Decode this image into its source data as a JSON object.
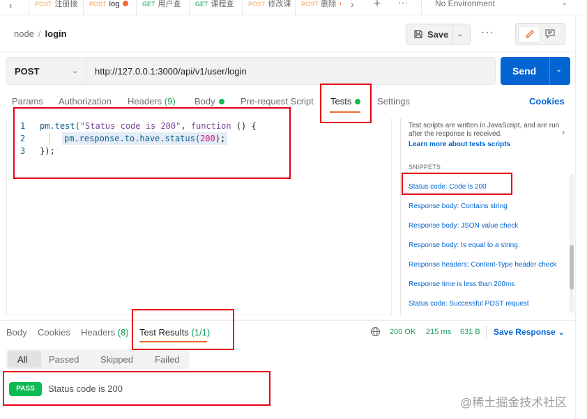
{
  "tabs": [
    {
      "method": "POST",
      "name": "注册接"
    },
    {
      "method": "POST",
      "name": "log"
    },
    {
      "method": "GET",
      "name": "用户查"
    },
    {
      "method": "GET",
      "name": "课程查"
    },
    {
      "method": "POST",
      "name": "修改课"
    },
    {
      "method": "POST",
      "name": "删除"
    }
  ],
  "environment": "No Environment",
  "breadcrumb": {
    "collection": "node",
    "separator": "/",
    "request": "login"
  },
  "toolbar": {
    "save_label": "Save"
  },
  "request": {
    "method": "POST",
    "url": "http://127.0.0.1:3000/api/v1/user/login",
    "send_label": "Send"
  },
  "request_tabs": {
    "params": "Params",
    "authorization": "Authorization",
    "headers": "Headers",
    "headers_count": "(9)",
    "body": "Body",
    "prerequest": "Pre-request Script",
    "tests": "Tests",
    "settings": "Settings",
    "cookies": "Cookies"
  },
  "editor": {
    "lines": [
      "1",
      "2",
      "3"
    ],
    "l1_a": "pm.test(",
    "l1_b": "\"Status code is 200\"",
    "l1_c": ", ",
    "l1_d": "function",
    "l1_e": " () {",
    "l2_a": "pm.response.to.have.status(",
    "l2_b": "200",
    "l2_c": ");",
    "l3": "});"
  },
  "snippets": {
    "help_text": "Test scripts are written in JavaScript, and are run after the response is received.",
    "help_link": "Learn more about tests scripts",
    "heading": "SNIPPETS",
    "items": [
      "Status code: Code is 200",
      "Response body: Contains string",
      "Response body: JSON value check",
      "Response body: Is equal to a string",
      "Response headers: Content-Type header check",
      "Response time is less than 200ms",
      "Status code: Successful POST request"
    ]
  },
  "response_tabs": {
    "body": "Body",
    "cookies": "Cookies",
    "headers": "Headers",
    "headers_count": "(8)",
    "test_results": "Test Results",
    "test_results_count": "(1/1)"
  },
  "response_meta": {
    "status": "200 OK",
    "time": "215 ms",
    "size": "631 B",
    "save_label": "Save Response"
  },
  "filters": [
    "All",
    "Passed",
    "Skipped",
    "Failed"
  ],
  "results": [
    {
      "badge": "PASS",
      "name": "Status code is 200"
    }
  ],
  "watermark": "@稀土掘金技术社区",
  "colors": {
    "accent": "#0265d2",
    "pass": "#0cbb52",
    "active_underline": "#ef6a2e",
    "annotation": "#e60012"
  }
}
